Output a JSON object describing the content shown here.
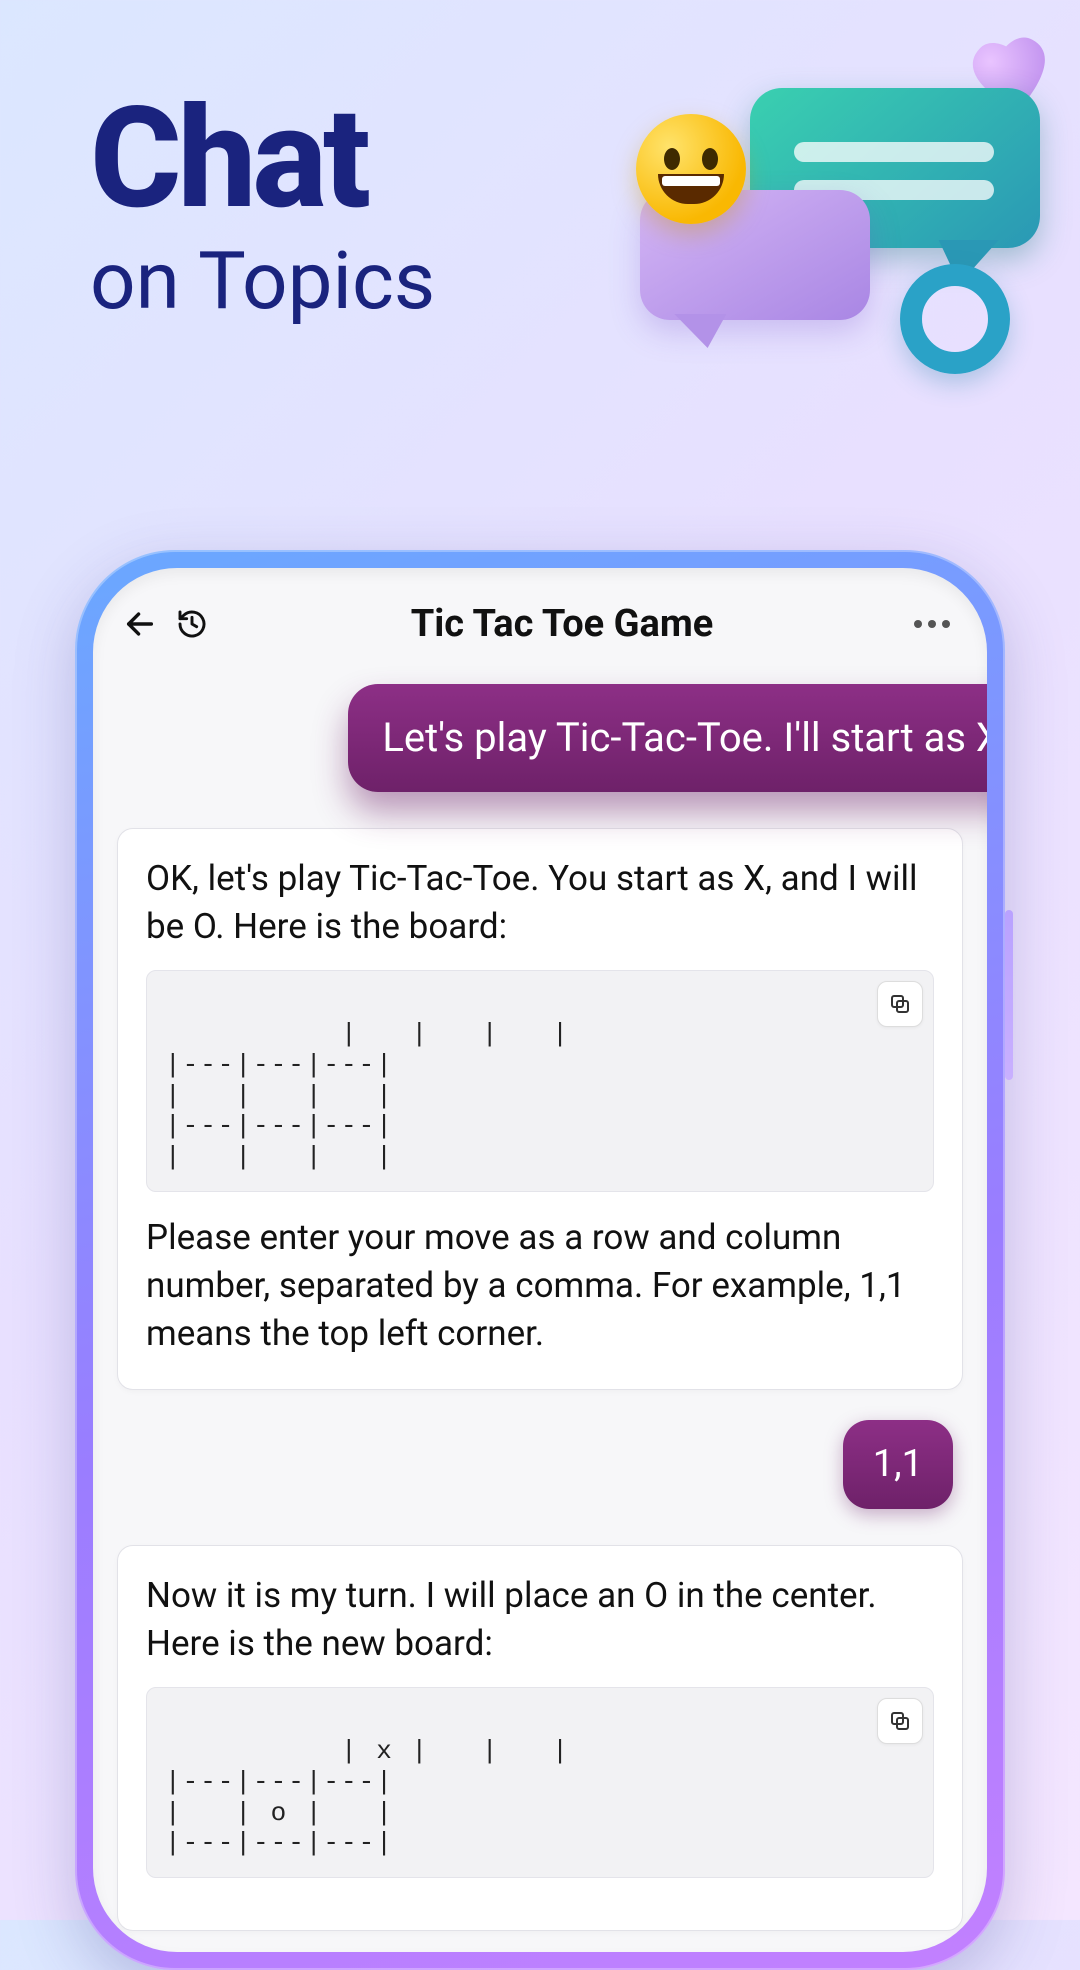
{
  "marketing": {
    "headline_big": "Chat",
    "headline_small": "on Topics"
  },
  "decoration": {
    "bubble_teal": "chat-bubble-teal-icon",
    "bubble_purple": "chat-bubble-purple-icon",
    "heart": "heart-icon",
    "ring": "ring-icon",
    "emoji": "grinning-emoji-icon"
  },
  "chat": {
    "title": "Tic Tac Toe Game",
    "toolbar": {
      "back": "back",
      "history": "history",
      "more": "more"
    },
    "messages": [
      {
        "role": "user",
        "text": "Let's play Tic-Tac-Toe. I'll start as X"
      },
      {
        "role": "assistant",
        "intro": "OK, let's play Tic-Tac-Toe. You start as X, and I will be O. Here is the board:",
        "board": "|   |   |   |\n|---|---|---|\n|   |   |   |\n|---|---|---|\n|   |   |   |",
        "instructions": "Please enter your move as a row and column number, separated by a comma. For example, 1,1 means the top left corner.",
        "copy_label": "Copy"
      },
      {
        "role": "user",
        "text": "1,1"
      },
      {
        "role": "assistant",
        "intro": "Now it is my turn. I will place an O in the center. Here is the new board:",
        "board": "| x |   |   |\n|---|---|---|\n|   | o |   |\n|---|---|---|",
        "copy_label": "Copy"
      }
    ]
  }
}
